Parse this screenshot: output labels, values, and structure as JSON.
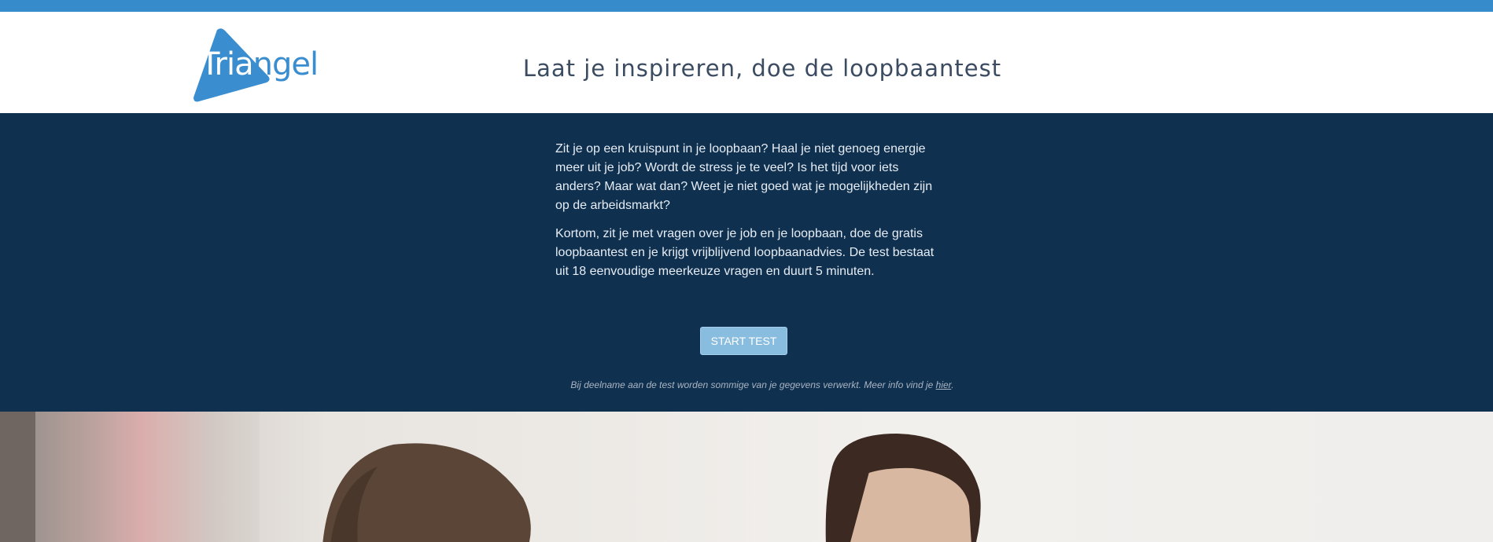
{
  "brand": {
    "logo_text_white": "Tria",
    "logo_text_blue": "ngel",
    "accent_color": "#368ccb",
    "navy_color": "#10304f"
  },
  "header": {
    "title": "Laat je inspireren, doe de loopbaantest"
  },
  "intro": {
    "paragraph_1": "Zit je op een kruispunt in je loopbaan? Haal je niet genoeg energie meer uit je job? Wordt de stress je te veel? Is het tijd voor iets anders? Maar wat dan? Weet je niet goed wat je mogelijkheden zijn op de arbeidsmarkt?",
    "paragraph_2": "Kortom, zit je met vragen over je job en je loopbaan, doe de gratis loopbaantest en je krijgt vrijblijvend loopbaanadvies. De test bestaat uit 18 eenvoudige meerkeuze vragen en duurt 5 minuten.",
    "start_button_label": "START TEST",
    "disclaimer_text": "Bij deelname aan de test worden sommige van je gegevens verwerkt. Meer info vind je ",
    "disclaimer_link": "hier",
    "disclaimer_end": "."
  }
}
